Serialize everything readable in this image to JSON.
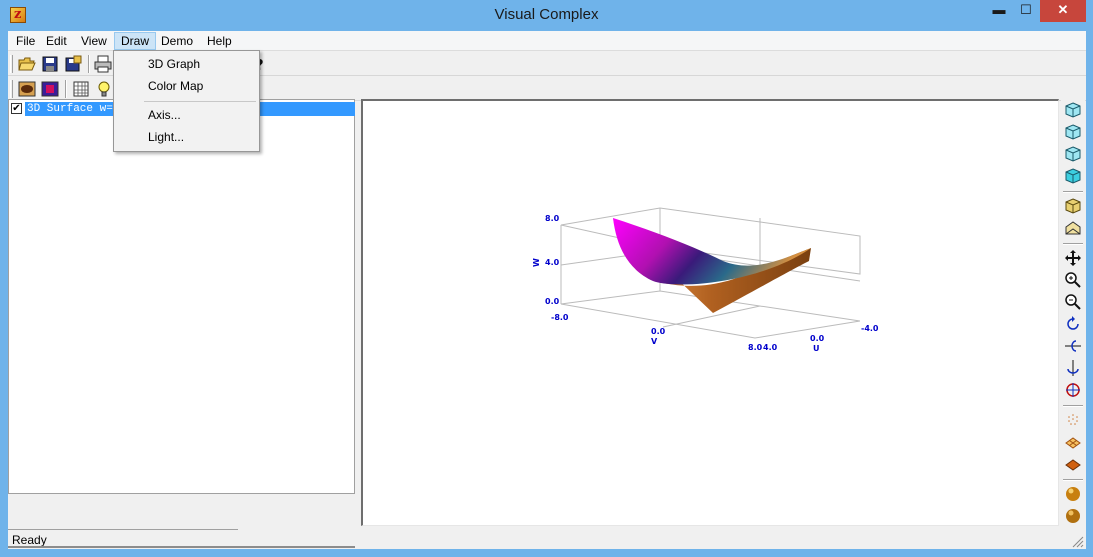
{
  "window": {
    "title": "Visual Complex",
    "min_glyph": "▬",
    "max_glyph": "☐",
    "close_glyph": "✕"
  },
  "menubar": {
    "items": [
      {
        "label": "File"
      },
      {
        "label": "Edit"
      },
      {
        "label": "View"
      },
      {
        "label": "Draw"
      },
      {
        "label": "Demo"
      },
      {
        "label": "Help"
      }
    ],
    "active": "Draw"
  },
  "draw_menu": {
    "items": [
      "3D Graph",
      "Color Map",
      "Axis...",
      "Light..."
    ]
  },
  "tree": {
    "items": [
      {
        "checked": true,
        "label": "3D Surface  w=u^2+v^2 ..."
      }
    ]
  },
  "status": {
    "text": "Ready"
  },
  "graph": {
    "chart_data": {
      "type": "3d-surface",
      "w_axis": {
        "label": "W",
        "ticks": [
          "0.0",
          "4.0",
          "8.0"
        ]
      },
      "v_axis": {
        "label": "V",
        "ticks": [
          "-8.0",
          "0.0",
          "8.0"
        ]
      },
      "u_axis": {
        "label": "U",
        "ticks": [
          "4.0",
          "0.0",
          "-4.0"
        ]
      },
      "colors": [
        "#ff00ff",
        "#8a2be2",
        "#1a3a8a",
        "#2a8a6a",
        "#d49a4a",
        "#f0a050"
      ]
    }
  },
  "toolbar_icons": [
    "open-icon",
    "save-icon",
    "save-as-icon",
    "print-icon",
    "help-icon"
  ],
  "toolbar2_icons": [
    "surface-icon",
    "colormap-icon",
    "grid-icon",
    "light-icon"
  ],
  "vtoolbar_icons": [
    "cube-view-1-icon",
    "cube-view-2-icon",
    "cube-view-3-icon",
    "cube-view-4-icon",
    "cube-solid-icon",
    "cube-open-icon",
    "move-icon",
    "zoom-in-icon",
    "zoom-out-icon",
    "rotate-z-icon",
    "rotate-x-icon",
    "rotate-y-icon",
    "rotate-free-icon",
    "dots-icon",
    "mesh-icon",
    "shaded-icon",
    "sphere-1-icon",
    "sphere-2-icon"
  ]
}
